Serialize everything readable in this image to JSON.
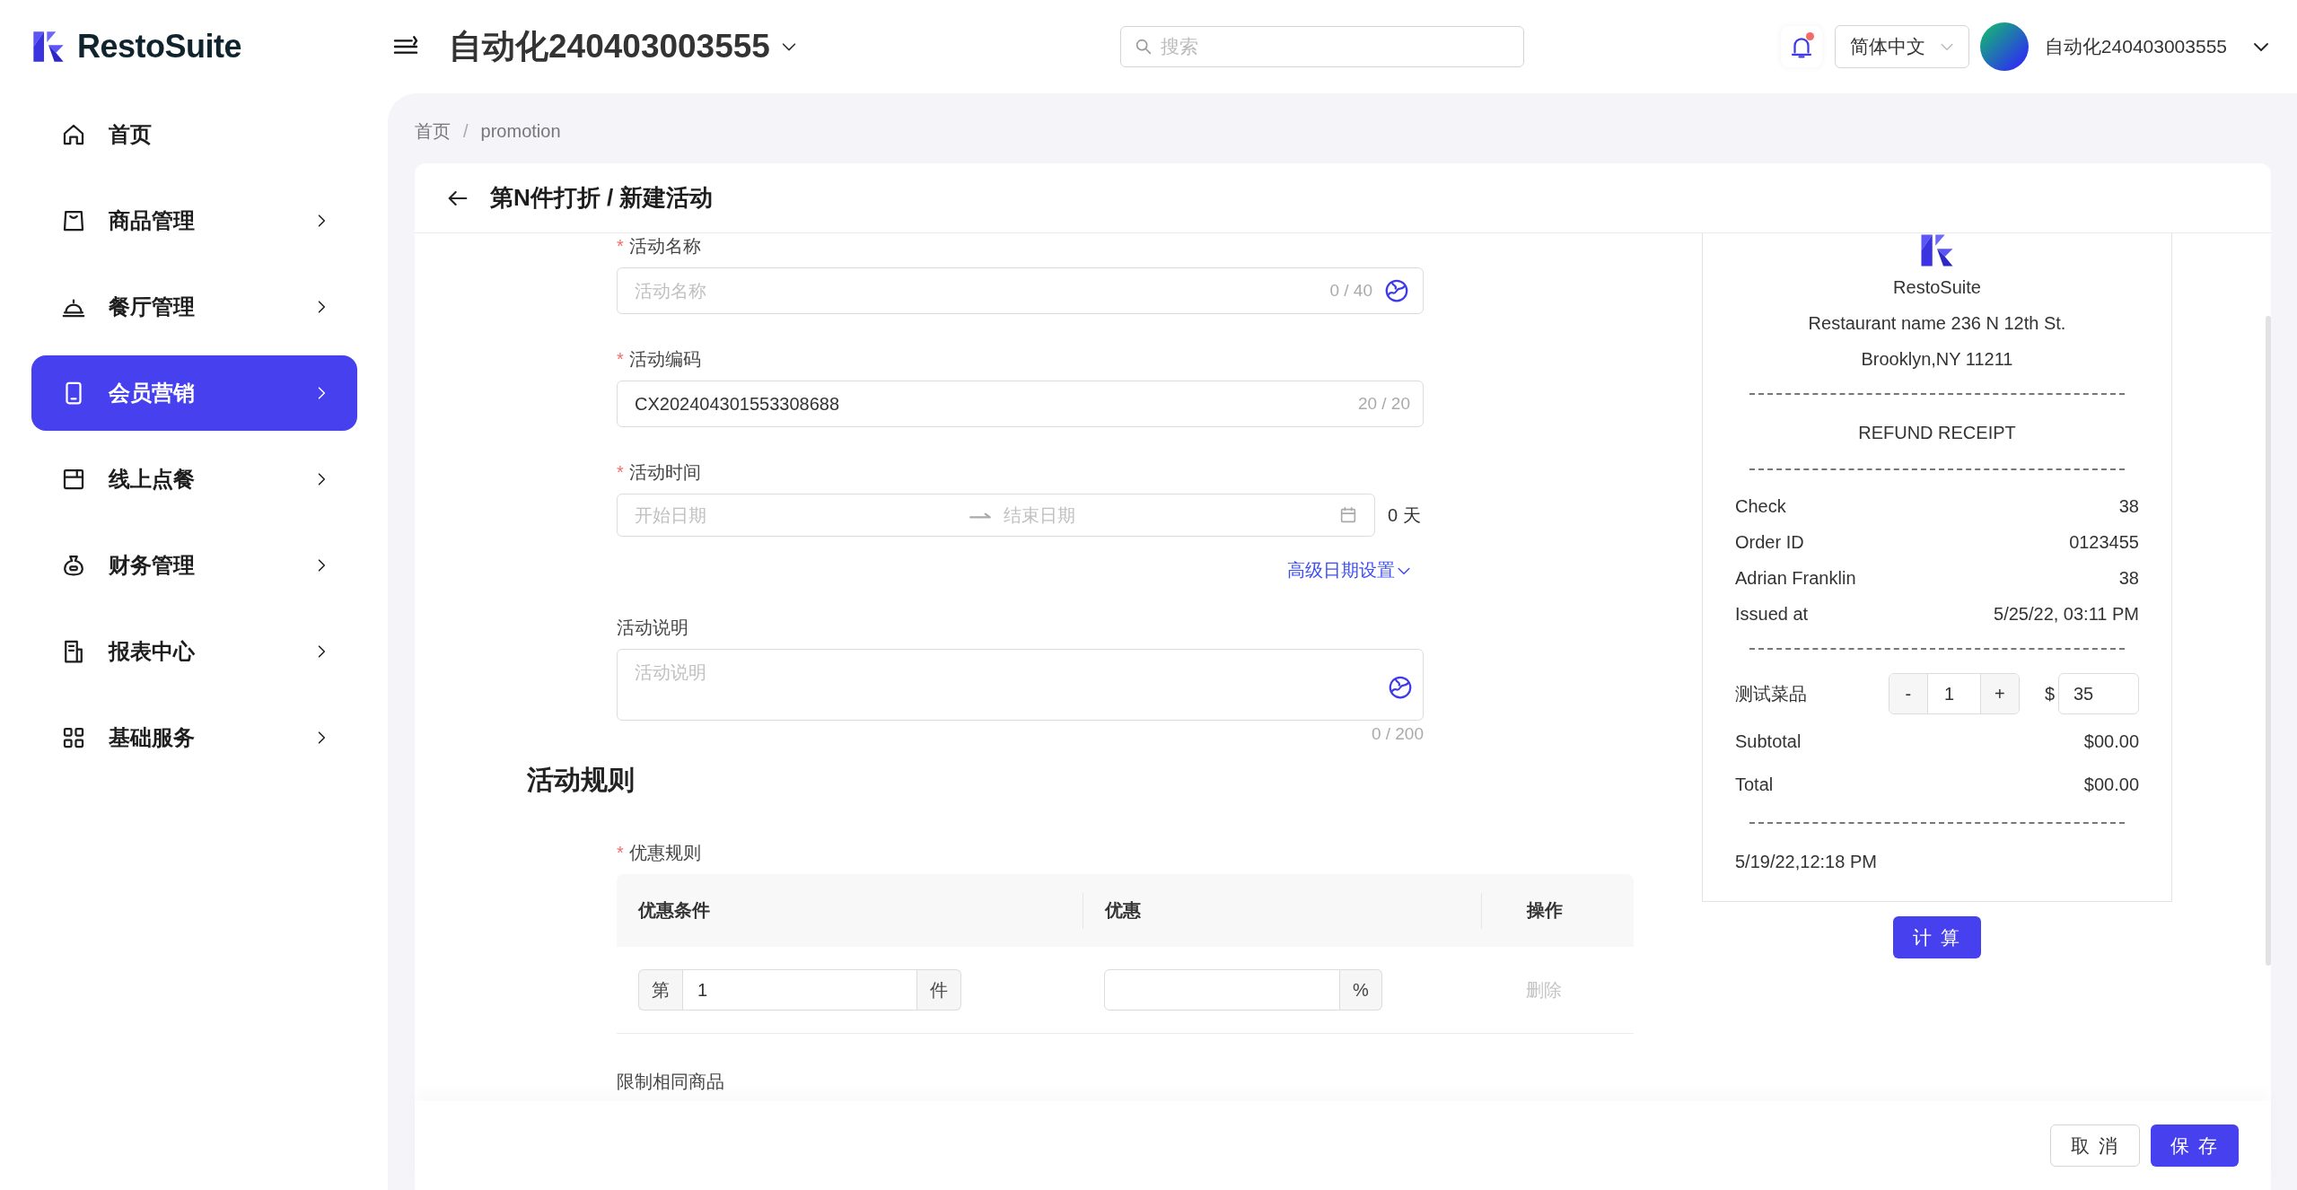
{
  "brand": {
    "name": "RestoSuite"
  },
  "header": {
    "store_title": "自动化240403003555",
    "search": {
      "placeholder": "搜索"
    },
    "notifications": {
      "unread": true
    },
    "language": "简体中文",
    "user": "自动化240403003555"
  },
  "sidebar": {
    "items": [
      {
        "label": "首页",
        "has_children": false,
        "selected": false
      },
      {
        "label": "商品管理",
        "has_children": true,
        "selected": false
      },
      {
        "label": "餐厅管理",
        "has_children": true,
        "selected": false
      },
      {
        "label": "会员营销",
        "has_children": true,
        "selected": true
      },
      {
        "label": "线上点餐",
        "has_children": true,
        "selected": false
      },
      {
        "label": "财务管理",
        "has_children": true,
        "selected": false
      },
      {
        "label": "报表中心",
        "has_children": true,
        "selected": false
      },
      {
        "label": "基础服务",
        "has_children": true,
        "selected": false
      }
    ]
  },
  "breadcrumb": {
    "items": [
      "首页",
      "promotion"
    ],
    "separator": "/"
  },
  "page": {
    "title": "第N件打折 / 新建活动"
  },
  "form": {
    "fields": [
      {
        "kind": "text",
        "label": "活动名称",
        "required_mark": "*",
        "placeholder": "活动名称",
        "counter": "0 / 40",
        "translate_button": true
      },
      {
        "kind": "text",
        "label": "活动编码",
        "required_mark": "*",
        "value": "CX202404301553308688",
        "counter": "20 / 20"
      },
      {
        "kind": "daterange",
        "label": "活动时间",
        "required_mark": "*",
        "start_placeholder": "开始日期",
        "end_placeholder": "结束日期",
        "days": "0 天",
        "link": "高级日期设置"
      },
      {
        "kind": "textarea",
        "label": "活动说明",
        "placeholder": "活动说明",
        "counter": "0 / 200",
        "translate_button": true
      }
    ]
  },
  "rules": {
    "title": "活动规则",
    "label": "优惠规则",
    "required_mark": "*",
    "columns": [
      "优惠条件",
      "优惠",
      "操作"
    ],
    "rows": [
      {
        "prefix": "第",
        "value": "1",
        "suffix": "件",
        "discount_suffix": "%",
        "action": "删除",
        "action_disabled": true
      }
    ],
    "next_label": "限制相同商品"
  },
  "receipt": {
    "brand": "RestoSuite",
    "address_lines": [
      "Restaurant name 236 N 12th St.",
      "Brooklyn,NY 11211"
    ],
    "title": "REFUND RECEIPT",
    "info": [
      {
        "label": "Check",
        "value": "38"
      },
      {
        "label": "Order ID",
        "value": "0123455"
      },
      {
        "label": "Adrian Franklin",
        "value": "38"
      },
      {
        "label": "Issued at",
        "value": "5/25/22, 03:11 PM"
      }
    ],
    "item": {
      "name": "测试菜品",
      "minus": "-",
      "qty": "1",
      "plus": "+",
      "currency": "$",
      "price": "35"
    },
    "totals": [
      {
        "label": "Subtotal",
        "value": "$00.00"
      },
      {
        "label": "Total",
        "value": "$00.00"
      }
    ],
    "footer_time": "5/19/22,12:18 PM",
    "button": "计 算"
  },
  "footer": {
    "buttons": [
      {
        "label": "取 消",
        "kind": "cancel"
      },
      {
        "label": "保 存",
        "kind": "primary"
      }
    ]
  }
}
